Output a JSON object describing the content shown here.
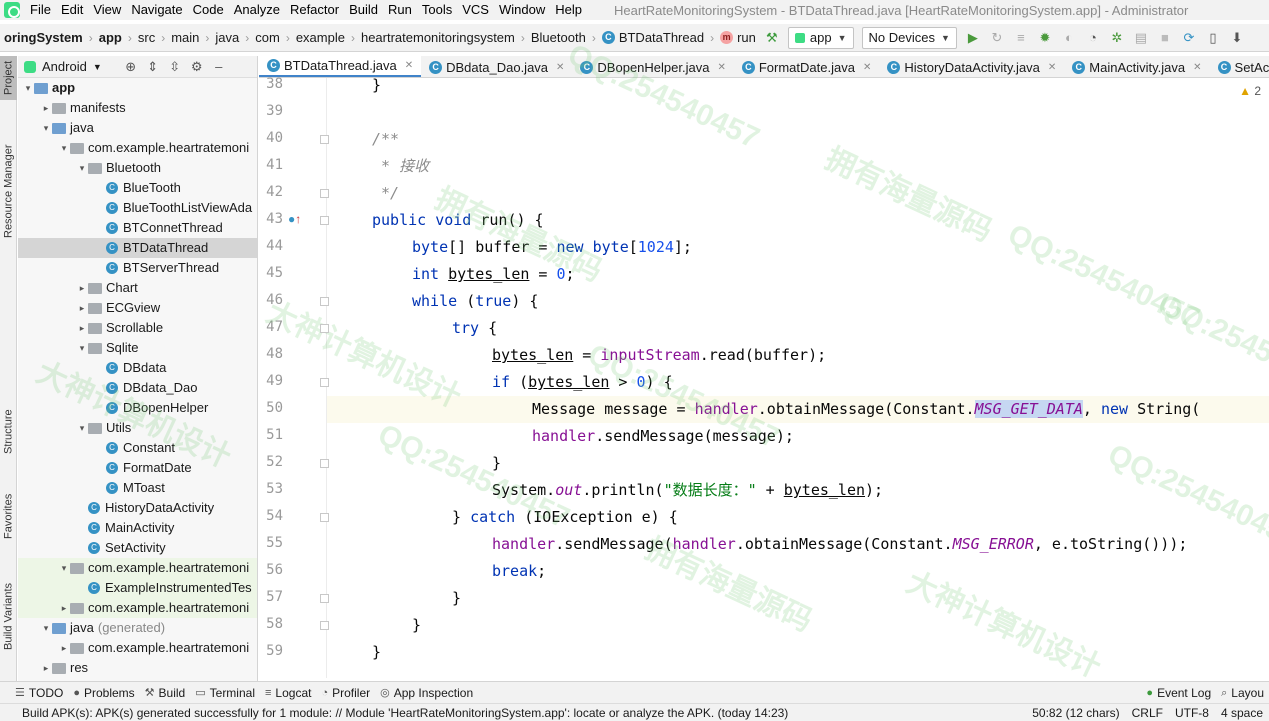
{
  "menu": {
    "items": [
      "File",
      "Edit",
      "View",
      "Navigate",
      "Code",
      "Analyze",
      "Refactor",
      "Build",
      "Run",
      "Tools",
      "VCS",
      "Window",
      "Help"
    ],
    "window_title": "HeartRateMonitoringSystem - BTDataThread.java [HeartRateMonitoringSystem.app] - Administrator"
  },
  "navbar": {
    "crumbs": [
      "oringSystem",
      "app",
      "src",
      "main",
      "java",
      "com",
      "example",
      "heartratemonitoringsystem",
      "Bluetooth",
      "BTDataThread",
      "run"
    ],
    "run_config": "app",
    "device": "No Devices"
  },
  "stripe": {
    "tabs": [
      "Project",
      "Resource Manager",
      "Structure",
      "Favorites",
      "Build Variants"
    ]
  },
  "project": {
    "view_mode": "Android",
    "tree": [
      {
        "label": "app",
        "depth": 0,
        "arrow": "▾",
        "kind": "module"
      },
      {
        "label": "manifests",
        "depth": 1,
        "arrow": "▸",
        "kind": "folder"
      },
      {
        "label": "java",
        "depth": 1,
        "arrow": "▾",
        "kind": "folder"
      },
      {
        "label": "com.example.heartratemoni",
        "depth": 2,
        "arrow": "▾",
        "kind": "pkg"
      },
      {
        "label": "Bluetooth",
        "depth": 3,
        "arrow": "▾",
        "kind": "pkg"
      },
      {
        "label": "BlueTooth",
        "depth": 4,
        "arrow": "",
        "kind": "cls"
      },
      {
        "label": "BlueToothListViewAda",
        "depth": 4,
        "arrow": "",
        "kind": "cls"
      },
      {
        "label": "BTConnetThread",
        "depth": 4,
        "arrow": "",
        "kind": "cls"
      },
      {
        "label": "BTDataThread",
        "depth": 4,
        "arrow": "",
        "kind": "cls",
        "selected": true
      },
      {
        "label": "BTServerThread",
        "depth": 4,
        "arrow": "",
        "kind": "cls"
      },
      {
        "label": "Chart",
        "depth": 3,
        "arrow": "▸",
        "kind": "pkg"
      },
      {
        "label": "ECGview",
        "depth": 3,
        "arrow": "▸",
        "kind": "pkg"
      },
      {
        "label": "Scrollable",
        "depth": 3,
        "arrow": "▸",
        "kind": "pkg"
      },
      {
        "label": "Sqlite",
        "depth": 3,
        "arrow": "▾",
        "kind": "pkg"
      },
      {
        "label": "DBdata",
        "depth": 4,
        "arrow": "",
        "kind": "cls"
      },
      {
        "label": "DBdata_Dao",
        "depth": 4,
        "arrow": "",
        "kind": "cls"
      },
      {
        "label": "DBopenHelper",
        "depth": 4,
        "arrow": "",
        "kind": "cls"
      },
      {
        "label": "Utils",
        "depth": 3,
        "arrow": "▾",
        "kind": "pkg"
      },
      {
        "label": "Constant",
        "depth": 4,
        "arrow": "",
        "kind": "cls"
      },
      {
        "label": "FormatDate",
        "depth": 4,
        "arrow": "",
        "kind": "cls"
      },
      {
        "label": "MToast",
        "depth": 4,
        "arrow": "",
        "kind": "cls"
      },
      {
        "label": "HistoryDataActivity",
        "depth": 3,
        "arrow": "",
        "kind": "cls"
      },
      {
        "label": "MainActivity",
        "depth": 3,
        "arrow": "",
        "kind": "cls"
      },
      {
        "label": "SetActivity",
        "depth": 3,
        "arrow": "",
        "kind": "cls"
      },
      {
        "label": "com.example.heartratemoni",
        "depth": 2,
        "arrow": "▾",
        "kind": "pkg",
        "green": true
      },
      {
        "label": "ExampleInstrumentedTes",
        "depth": 3,
        "arrow": "",
        "kind": "cls",
        "green": true
      },
      {
        "label": "com.example.heartratemoni",
        "depth": 2,
        "arrow": "▸",
        "kind": "pkg",
        "green": true
      },
      {
        "label": "java",
        "suffix": "(generated)",
        "depth": 1,
        "arrow": "▾",
        "kind": "folder"
      },
      {
        "label": "com.example.heartratemoni",
        "depth": 2,
        "arrow": "▸",
        "kind": "pkg"
      },
      {
        "label": "res",
        "depth": 1,
        "arrow": "▸",
        "kind": "folder"
      }
    ]
  },
  "tabs": [
    "BTDataThread.java",
    "DBdata_Dao.java",
    "DBopenHelper.java",
    "FormatDate.java",
    "HistoryDataActivity.java",
    "MainActivity.java",
    "SetActiv"
  ],
  "editor": {
    "warnings": "2",
    "lines": [
      {
        "n": "38",
        "indent": 0,
        "tokens": [
          {
            "t": "}",
            "c": ""
          }
        ]
      },
      {
        "n": "39",
        "indent": 0,
        "tokens": []
      },
      {
        "n": "40",
        "indent": 0,
        "tokens": [
          {
            "t": "/**",
            "c": "cmt"
          }
        ]
      },
      {
        "n": "41",
        "indent": 0,
        "tokens": [
          {
            "t": " * 接收",
            "c": "cmt"
          }
        ]
      },
      {
        "n": "42",
        "indent": 0,
        "tokens": [
          {
            "t": " */",
            "c": "cmt"
          }
        ]
      },
      {
        "n": "43",
        "indent": 0,
        "tokens": [
          {
            "t": "public void ",
            "c": "kw"
          },
          {
            "t": "run",
            "c": ""
          },
          {
            "t": "() {",
            "c": ""
          }
        ]
      },
      {
        "n": "44",
        "indent": 1,
        "tokens": [
          {
            "t": "byte",
            "c": "kw"
          },
          {
            "t": "[] buffer = ",
            "c": ""
          },
          {
            "t": "new byte",
            "c": "kw"
          },
          {
            "t": "[",
            "c": ""
          },
          {
            "t": "1024",
            "c": "num"
          },
          {
            "t": "];",
            "c": ""
          }
        ]
      },
      {
        "n": "45",
        "indent": 1,
        "tokens": [
          {
            "t": "int ",
            "c": "kw"
          },
          {
            "t": "bytes_len",
            "c": "under"
          },
          {
            "t": " = ",
            "c": ""
          },
          {
            "t": "0",
            "c": "num"
          },
          {
            "t": ";",
            "c": ""
          }
        ]
      },
      {
        "n": "46",
        "indent": 1,
        "tokens": [
          {
            "t": "while ",
            "c": "kw"
          },
          {
            "t": "(",
            "c": ""
          },
          {
            "t": "true",
            "c": "kw"
          },
          {
            "t": ") {",
            "c": ""
          }
        ]
      },
      {
        "n": "47",
        "indent": 2,
        "tokens": [
          {
            "t": "try ",
            "c": "kw"
          },
          {
            "t": "{",
            "c": ""
          }
        ]
      },
      {
        "n": "48",
        "indent": 3,
        "tokens": [
          {
            "t": "bytes_len",
            "c": "under"
          },
          {
            "t": " = ",
            "c": ""
          },
          {
            "t": "inputStream",
            "c": "fld"
          },
          {
            "t": ".read(buffer);",
            "c": ""
          }
        ]
      },
      {
        "n": "49",
        "indent": 3,
        "tokens": [
          {
            "t": "if ",
            "c": "kw"
          },
          {
            "t": "(",
            "c": ""
          },
          {
            "t": "bytes_len",
            "c": "under"
          },
          {
            "t": " > ",
            "c": ""
          },
          {
            "t": "0",
            "c": "num"
          },
          {
            "t": ") {",
            "c": ""
          }
        ]
      },
      {
        "n": "50",
        "indent": 4,
        "caret": true,
        "tokens": [
          {
            "t": "Message message = ",
            "c": ""
          },
          {
            "t": "handler",
            "c": "fld"
          },
          {
            "t": ".obtainMessage(Constant.",
            "c": ""
          },
          {
            "t": "MSG_GET_DATA",
            "c": "stat hl"
          },
          {
            "t": ", ",
            "c": ""
          },
          {
            "t": "new ",
            "c": "kw"
          },
          {
            "t": "String(",
            "c": ""
          }
        ]
      },
      {
        "n": "51",
        "indent": 4,
        "tokens": [
          {
            "t": "handler",
            "c": "fld"
          },
          {
            "t": ".sendMessage(message);",
            "c": ""
          }
        ]
      },
      {
        "n": "52",
        "indent": 3,
        "tokens": [
          {
            "t": "}",
            "c": ""
          }
        ]
      },
      {
        "n": "53",
        "indent": 3,
        "tokens": [
          {
            "t": "System.",
            "c": ""
          },
          {
            "t": "out",
            "c": "stat"
          },
          {
            "t": ".println(",
            "c": ""
          },
          {
            "t": "\"数据长度：\"",
            "c": "str"
          },
          {
            "t": " + ",
            "c": ""
          },
          {
            "t": "bytes_len",
            "c": "under"
          },
          {
            "t": ");",
            "c": ""
          }
        ]
      },
      {
        "n": "54",
        "indent": 2,
        "tokens": [
          {
            "t": "} ",
            "c": ""
          },
          {
            "t": "catch ",
            "c": "kw"
          },
          {
            "t": "(IOException e) {",
            "c": ""
          }
        ]
      },
      {
        "n": "55",
        "indent": 3,
        "tokens": [
          {
            "t": "handler",
            "c": "fld"
          },
          {
            "t": ".sendMessage(",
            "c": ""
          },
          {
            "t": "handler",
            "c": "fld"
          },
          {
            "t": ".obtainMessage(Constant.",
            "c": ""
          },
          {
            "t": "MSG_ERROR",
            "c": "stat"
          },
          {
            "t": ", e.toString()));",
            "c": ""
          }
        ]
      },
      {
        "n": "56",
        "indent": 3,
        "tokens": [
          {
            "t": "break",
            "c": "kw"
          },
          {
            "t": ";",
            "c": ""
          }
        ]
      },
      {
        "n": "57",
        "indent": 2,
        "tokens": [
          {
            "t": "}",
            "c": ""
          }
        ]
      },
      {
        "n": "58",
        "indent": 1,
        "tokens": [
          {
            "t": "}",
            "c": ""
          }
        ]
      },
      {
        "n": "59",
        "indent": 0,
        "tokens": [
          {
            "t": "}",
            "c": ""
          }
        ]
      }
    ]
  },
  "bottom_tools": [
    "TODO",
    "Problems",
    "Build",
    "Terminal",
    "Logcat",
    "Profiler",
    "App Inspection"
  ],
  "bottom_tools_right": [
    "Event Log",
    "Layou"
  ],
  "status": {
    "message": "Build APK(s): APK(s) generated successfully for 1 module: // Module 'HeartRateMonitoringSystem.app': locate or analyze the APK. (today 14:23)",
    "position": "50:82 (12 chars)",
    "line_sep": "CRLF",
    "encoding": "UTF-8",
    "indent": "4 space"
  },
  "watermark": [
    "QQ:254540457",
    "大神计算机设计",
    "拥有海量源码"
  ]
}
